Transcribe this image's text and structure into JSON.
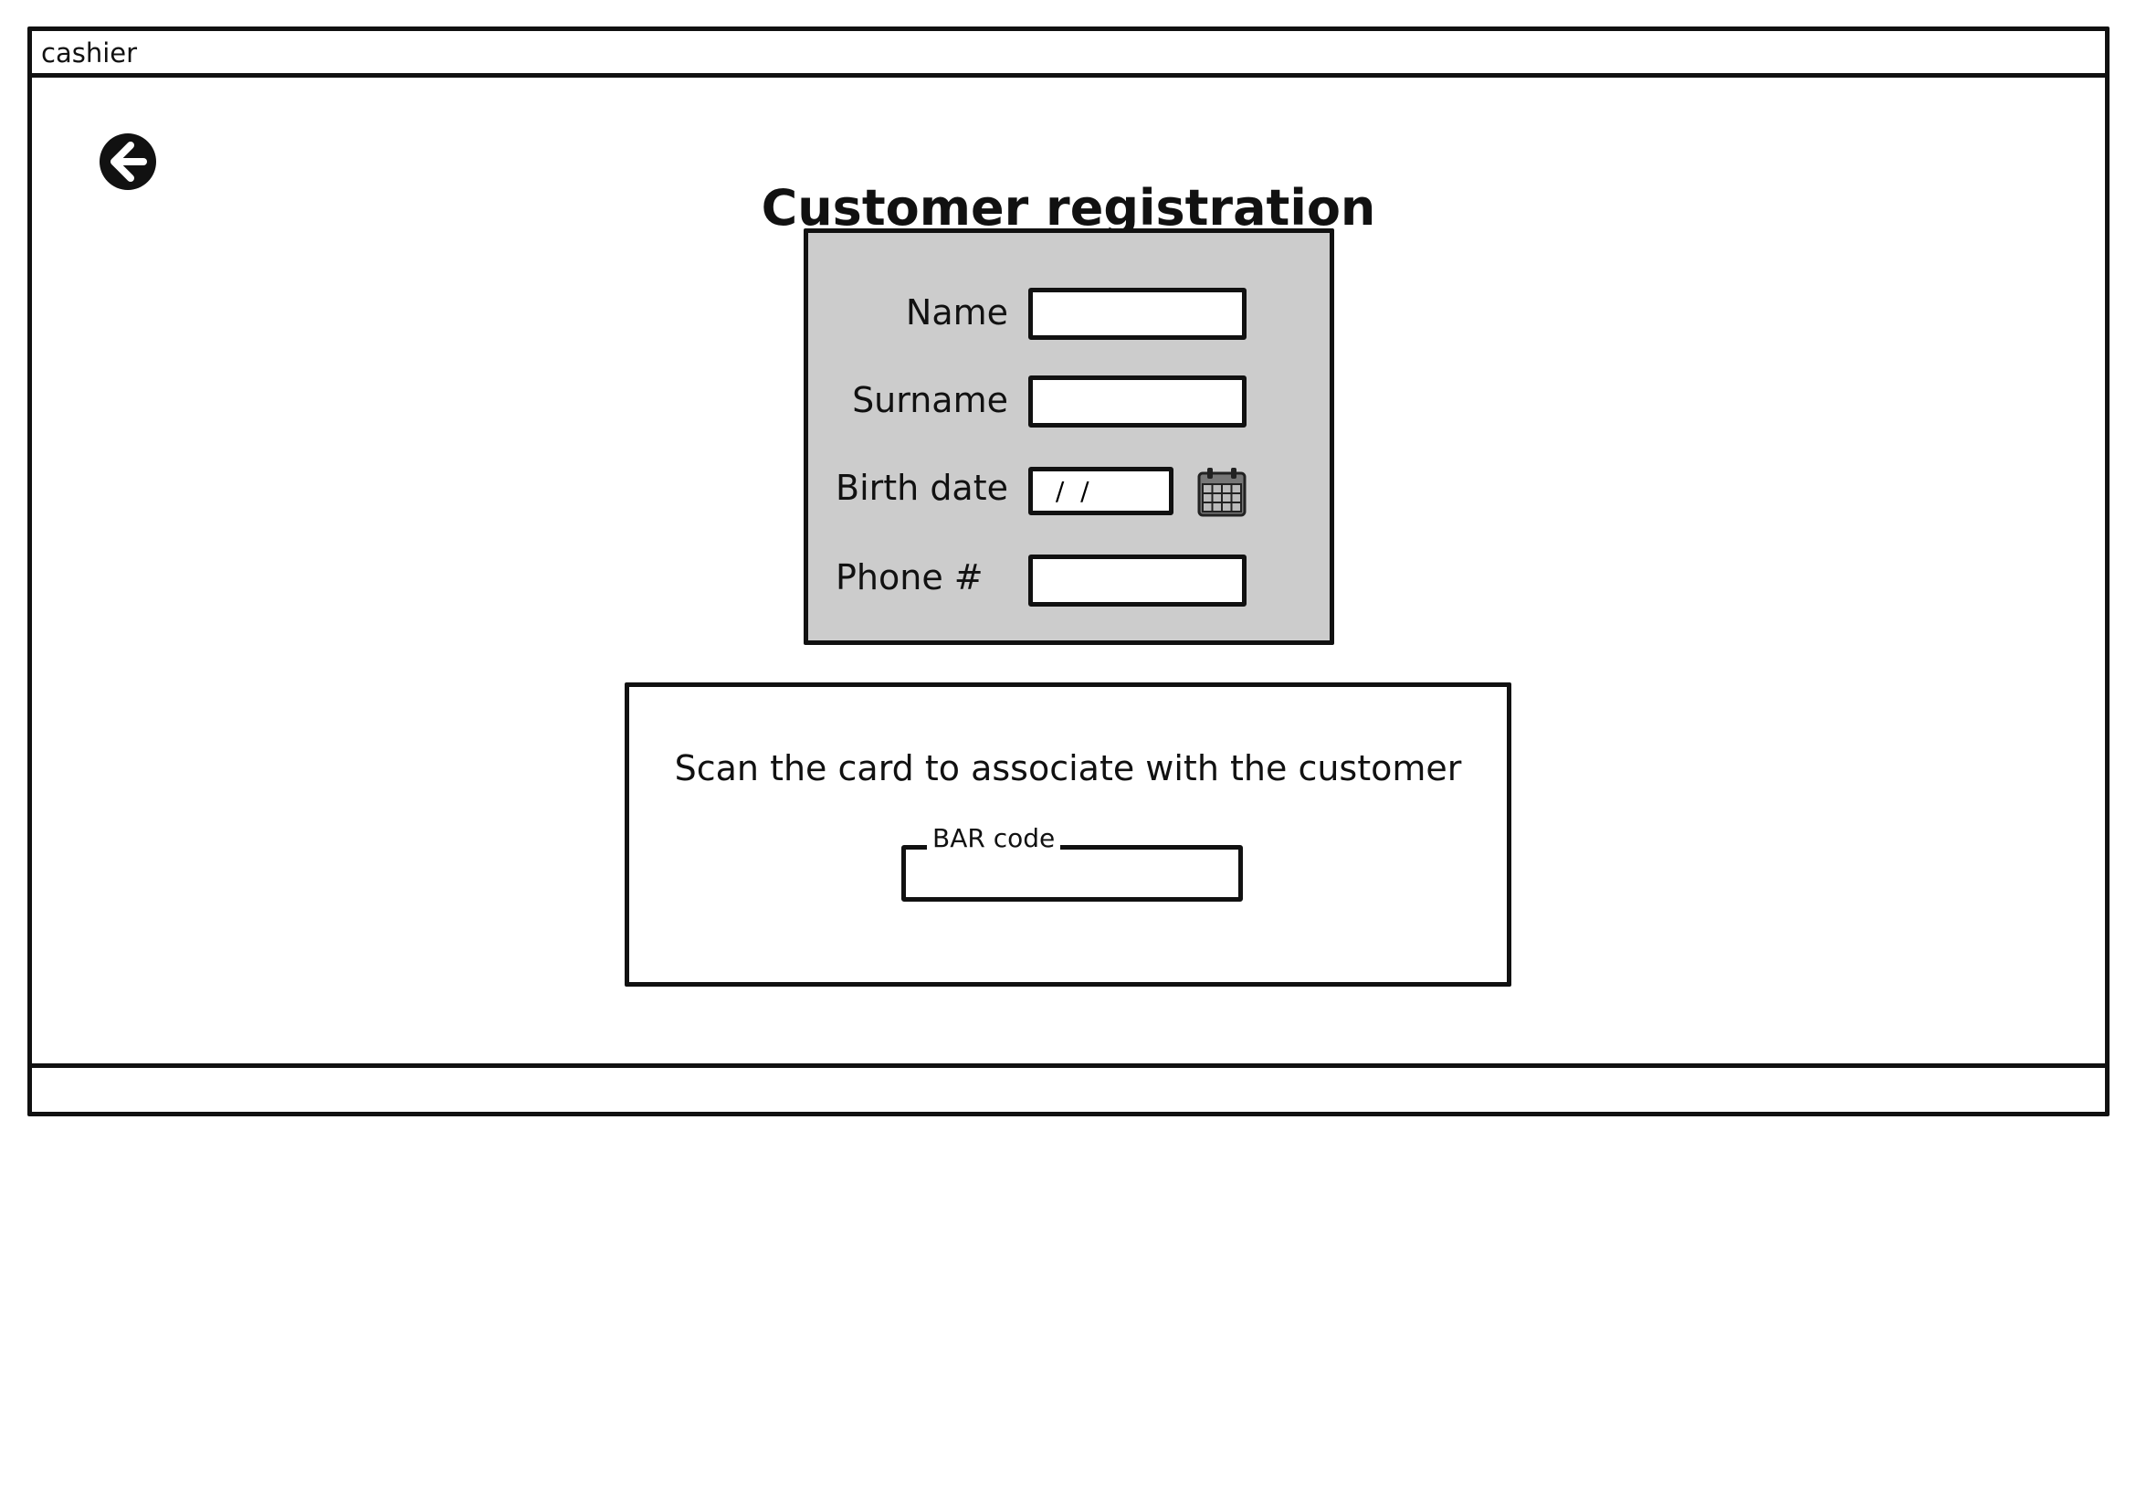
{
  "window": {
    "title": "cashier"
  },
  "header": {
    "back_icon": "arrow-left-circle-icon",
    "page_title": "Customer registration"
  },
  "form": {
    "name_label": "Name",
    "name_value": "",
    "surname_label": "Surname",
    "surname_value": "",
    "birth_date_label": "Birth date",
    "birth_date_value": " /  /",
    "calendar_icon": "calendar-icon",
    "phone_label": "Phone #",
    "phone_value": ""
  },
  "scan": {
    "instruction": "Scan the card to associate with the customer",
    "barcode_label": "BAR code",
    "barcode_value": ""
  },
  "colors": {
    "panel_background": "#cccccc",
    "stroke": "#111111",
    "background": "#ffffff"
  }
}
